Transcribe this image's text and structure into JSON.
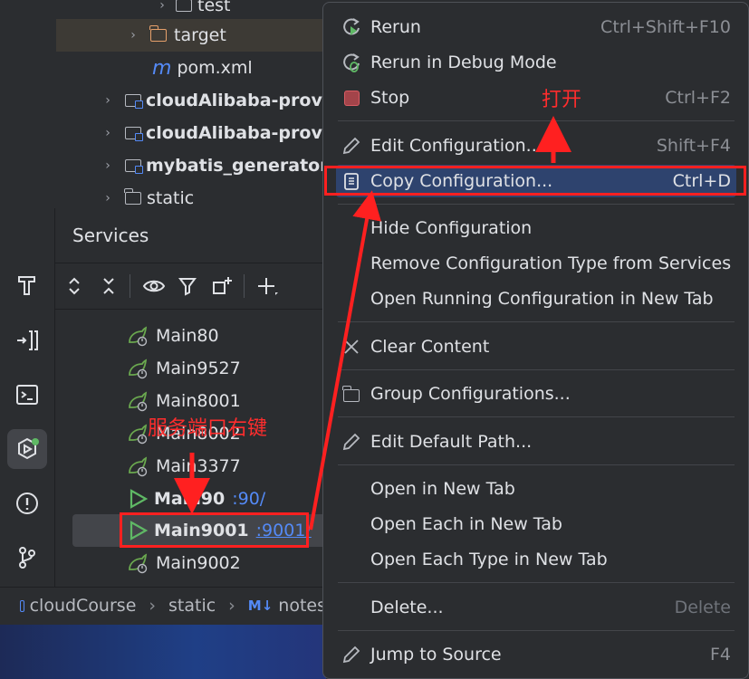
{
  "project_tree": {
    "items": [
      {
        "label": "test",
        "kind": "folder"
      },
      {
        "label": "target",
        "kind": "folder-orange"
      },
      {
        "label": "pom.xml",
        "kind": "maven-file"
      },
      {
        "label": "cloudAlibaba-prov",
        "kind": "module"
      },
      {
        "label": "cloudAlibaba-prov",
        "kind": "module"
      },
      {
        "label": "mybatis_generator",
        "kind": "module"
      },
      {
        "label": "static",
        "kind": "folder"
      }
    ]
  },
  "services": {
    "title": "Services",
    "rows": [
      {
        "label": "Main80",
        "port": "",
        "state": "idle"
      },
      {
        "label": "Main9527",
        "port": "",
        "state": "idle"
      },
      {
        "label": "Main8001",
        "port": "",
        "state": "idle"
      },
      {
        "label": "Main8002",
        "port": "",
        "state": "idle"
      },
      {
        "label": "Main3377",
        "port": "",
        "state": "idle"
      },
      {
        "label": "Main90",
        "port": ":90/",
        "state": "running"
      },
      {
        "label": "Main9001",
        "port": ":9001/",
        "state": "running-selected"
      },
      {
        "label": "Main9002",
        "port": "",
        "state": "idle"
      }
    ]
  },
  "breadcrumb": {
    "items": [
      "cloudCourse",
      "static",
      "notes"
    ],
    "md_badge": "M↓"
  },
  "context_menu": {
    "items": [
      {
        "label": "Rerun",
        "shortcut": "Ctrl+Shift+F10",
        "icon": "rerun-icon"
      },
      {
        "label": "Rerun in Debug Mode",
        "shortcut": "",
        "icon": "debug-rerun-icon"
      },
      {
        "label": "Stop",
        "shortcut": "Ctrl+F2",
        "icon": "stop-icon"
      },
      {
        "label": "Edit Configuration...",
        "shortcut": "Shift+F4",
        "icon": "pencil-icon"
      },
      {
        "label": "Copy Configuration...",
        "shortcut": "Ctrl+D",
        "icon": "copy-icon",
        "active": true
      },
      {
        "label": "Hide Configuration",
        "shortcut": "",
        "icon": ""
      },
      {
        "label": "Remove Configuration Type from Services",
        "shortcut": "",
        "icon": ""
      },
      {
        "label": "Open Running Configuration in New Tab",
        "shortcut": "",
        "icon": ""
      },
      {
        "label": "Clear Content",
        "shortcut": "",
        "icon": "clear-icon"
      },
      {
        "label": "Group Configurations...",
        "shortcut": "",
        "icon": "folder-icon"
      },
      {
        "label": "Edit Default Path...",
        "shortcut": "",
        "icon": "pencil-icon"
      },
      {
        "label": "Open in New Tab",
        "shortcut": "",
        "icon": ""
      },
      {
        "label": "Open Each in New Tab",
        "shortcut": "",
        "icon": ""
      },
      {
        "label": "Open Each Type in New Tab",
        "shortcut": "",
        "icon": ""
      },
      {
        "label": "Delete...",
        "shortcut": "Delete",
        "icon": ""
      },
      {
        "label": "Jump to Source",
        "shortcut": "F4",
        "icon": "pencil-icon"
      }
    ]
  },
  "annotations": {
    "open_note": "打开",
    "right_click_note": "服务端口右键"
  },
  "colors": {
    "annotation_red": "#ff2020",
    "selection_blue": "#2e436e",
    "link_blue": "#548af7",
    "run_green": "#5fb865"
  }
}
